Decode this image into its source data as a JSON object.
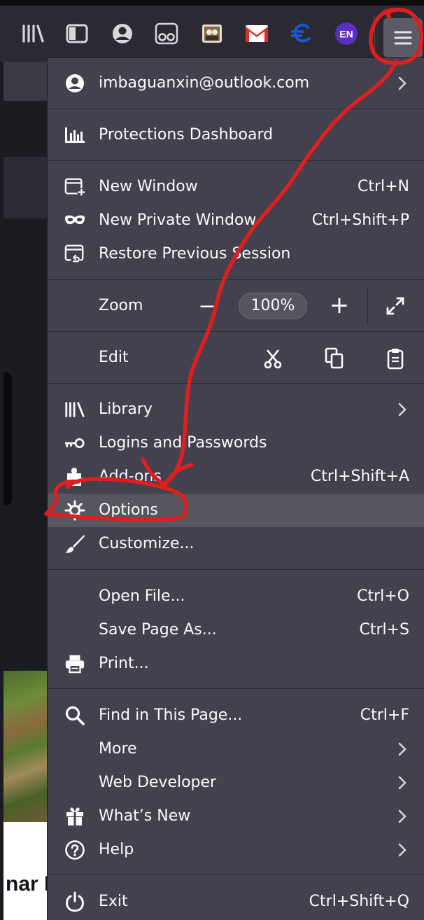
{
  "toolbar": {
    "icons": [
      "library-icon",
      "sidebar-icon",
      "account-icon",
      "reader-icon",
      "extension-photo-icon",
      "gmail-icon",
      "euro-icon",
      "language-badge-icon",
      "menu-icon"
    ],
    "language_badge": "EN",
    "colors": {
      "gmail_red": "#d93025",
      "euro_blue": "#1a57d6",
      "badge_purple": "#5b2fc4"
    }
  },
  "background_page": {
    "visible_text": "nar N"
  },
  "menu": {
    "account": {
      "email": "imbaguanxin@outlook.com"
    },
    "protections": {
      "label": "Protections Dashboard"
    },
    "new_window": {
      "label": "New Window",
      "shortcut": "Ctrl+N"
    },
    "private_window": {
      "label": "New Private Window",
      "shortcut": "Ctrl+Shift+P"
    },
    "restore_session": {
      "label": "Restore Previous Session"
    },
    "zoom": {
      "label": "Zoom",
      "minus": "−",
      "value": "100%",
      "plus": "+"
    },
    "edit": {
      "label": "Edit"
    },
    "library": {
      "label": "Library"
    },
    "logins": {
      "label": "Logins and Passwords"
    },
    "addons": {
      "label": "Add-ons",
      "shortcut": "Ctrl+Shift+A"
    },
    "options": {
      "label": "Options"
    },
    "customize": {
      "label": "Customize..."
    },
    "open_file": {
      "label": "Open File...",
      "shortcut": "Ctrl+O"
    },
    "save_page": {
      "label": "Save Page As...",
      "shortcut": "Ctrl+S"
    },
    "print": {
      "label": "Print..."
    },
    "find": {
      "label": "Find in This Page...",
      "shortcut": "Ctrl+F"
    },
    "more": {
      "label": "More"
    },
    "web_developer": {
      "label": "Web Developer"
    },
    "whats_new": {
      "label": "What’s New"
    },
    "help": {
      "label": "Help"
    },
    "exit": {
      "label": "Exit",
      "shortcut": "Ctrl+Shift+Q"
    }
  },
  "annotation": {
    "color": "#e01e1e",
    "marks": [
      "circle-around-menu-button",
      "arrow-to-options",
      "circle-around-options"
    ]
  }
}
